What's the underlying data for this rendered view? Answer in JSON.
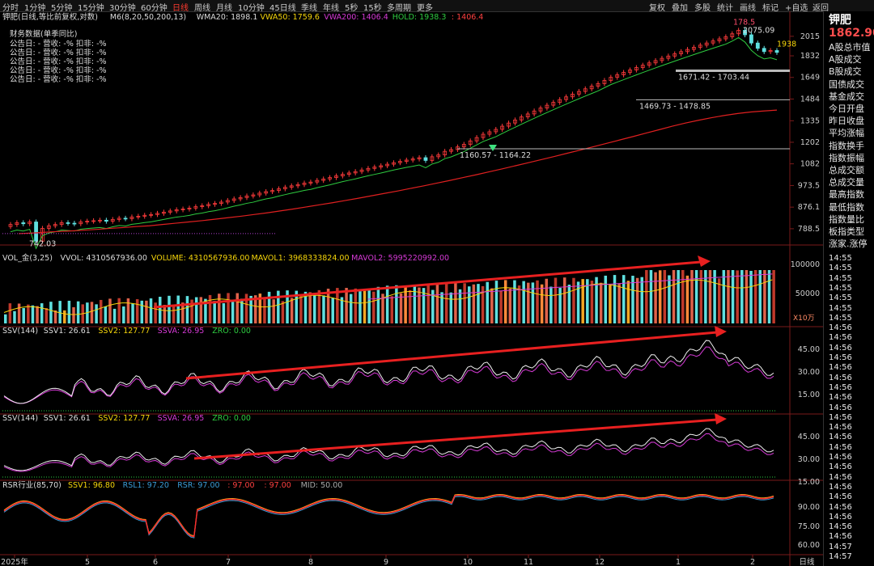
{
  "toolbar": {
    "left_items": [
      "分时",
      "1分钟",
      "5分钟",
      "15分钟",
      "30分钟",
      "60分钟",
      "日线",
      "周线",
      "月线",
      "10分钟",
      "45日线",
      "季线",
      "年线",
      "5秒",
      "15秒",
      "多周期",
      "更多"
    ],
    "active": "日线",
    "right_items": [
      "复权",
      "叠加",
      "多股",
      "统计",
      "画线",
      "标记",
      "+自选",
      "返回"
    ]
  },
  "right_panel": {
    "stock": "钾肥",
    "price": "1862.90",
    "items": [
      "A股总市值",
      "A股成交",
      "B股成交",
      "国债成交",
      "基金成交",
      "今日开盘",
      "昨日收盘",
      "平均涨幅",
      "指数换手",
      "指数振幅",
      "总成交额",
      "总成交量",
      "最高指数",
      "最低指数",
      "指数量比",
      "板指类型",
      "涨家.涨停"
    ],
    "times": [
      "14:55",
      "14:55",
      "14:55",
      "14:55",
      "14:55",
      "14:55",
      "14:55",
      "14:56",
      "14:56",
      "14:56",
      "14:56",
      "14:56",
      "14:56",
      "14:56",
      "14:56",
      "14:56",
      "14:56",
      "14:56",
      "14:56",
      "14:56",
      "14:56",
      "14:56",
      "14:56",
      "14:56",
      "14:56",
      "14:56",
      "14:56",
      "14:56",
      "14:56",
      "14:57",
      "14:57"
    ]
  },
  "panel_headers": {
    "main": [
      {
        "text": "钾肥(日线,等比前复权,对数)",
        "color": "#dddddd"
      },
      {
        "text": "M6(8,20,50,200,13)",
        "color": "#dddddd"
      },
      {
        "text": "WMA20: 1898.1",
        "color": "#dddddd"
      },
      {
        "text": "VWA50: 1759.6",
        "color": "#f5d50a"
      },
      {
        "text": "VWA200: 1406.4",
        "color": "#d63ad6"
      },
      {
        "text": "HOLD: 1938.3",
        "color": "#2ecc40"
      },
      {
        "text": ": 1406.4",
        "color": "#ff4040"
      }
    ],
    "finance_title": "财务数据(单季同比)",
    "finance_rows": [
      "公告日: -  营收: -%  扣非: -%",
      "公告日: -  营收: -%  扣非: -%",
      "公告日: -  营收: -%  扣非: -%",
      "公告日: -  营收: -%  扣非: -%",
      "公告日: -  营收: -%  扣非: -%"
    ],
    "vol": [
      {
        "text": "VOL_金(3,25)",
        "color": "#dddddd"
      },
      {
        "text": "VVOL: 4310567936.00",
        "color": "#dddddd"
      },
      {
        "text": "VOLUME: 4310567936.00",
        "color": "#f5d50a"
      },
      {
        "text": "MAVOL1: 3968333824.00",
        "color": "#f5d50a"
      },
      {
        "text": "MAVOL2: 5995220992.00",
        "color": "#d63ad6"
      }
    ],
    "ssv1": [
      {
        "text": "SSV(144)",
        "color": "#dddddd"
      },
      {
        "text": "SSV1: 26.61",
        "color": "#dddddd"
      },
      {
        "text": "SSV2: 127.77",
        "color": "#f5d50a"
      },
      {
        "text": "SSVA: 26.95",
        "color": "#d63ad6"
      },
      {
        "text": "ZRO: 0.00",
        "color": "#2ecc40"
      }
    ],
    "ssv2": [
      {
        "text": "SSV(144)",
        "color": "#dddddd"
      },
      {
        "text": "SSV1: 26.61",
        "color": "#dddddd"
      },
      {
        "text": "SSV2: 127.77",
        "color": "#f5d50a"
      },
      {
        "text": "SSVA: 26.95",
        "color": "#d63ad6"
      },
      {
        "text": "ZRO: 0.00",
        "color": "#2ecc40"
      }
    ],
    "rsr": [
      {
        "text": "RSR行业(85,70)",
        "color": "#dddddd"
      },
      {
        "text": "SSV1: 96.80",
        "color": "#f5d50a"
      },
      {
        "text": "RSL1: 97.20",
        "color": "#3a9bd6"
      },
      {
        "text": "RSR: 97.00",
        "color": "#3a9bd6"
      },
      {
        "text": ": 97.00",
        "color": "#ff4040"
      },
      {
        "text": ": 97.00",
        "color": "#ff4040"
      },
      {
        "text": "MID: 50.00",
        "color": "#aaaaaa"
      }
    ]
  },
  "chart_data": {
    "type": "line",
    "price_axis_ticks": [
      "2015",
      "1832",
      "1649",
      "1484",
      "1335",
      "1202",
      "1082",
      "973.5",
      "876.1",
      "788.5"
    ],
    "price_range": [
      740,
      2120
    ],
    "months": [
      "2025年",
      "5",
      "6",
      "7",
      "8",
      "9",
      "10",
      "11",
      "12",
      "1",
      "2"
    ],
    "period_label": "日线",
    "close": [
      805,
      812,
      808,
      815,
      742,
      790,
      800,
      805,
      812,
      810,
      808,
      815,
      818,
      820,
      822,
      818,
      825,
      830,
      828,
      835,
      838,
      842,
      845,
      850,
      855,
      860,
      865,
      868,
      872,
      878,
      882,
      888,
      892,
      898,
      905,
      912,
      918,
      925,
      930,
      938,
      945,
      950,
      958,
      965,
      972,
      978,
      985,
      990,
      998,
      1005,
      1012,
      1020,
      1028,
      1035,
      1042,
      1050,
      1058,
      1065,
      1072,
      1080,
      1088,
      1095,
      1102,
      1108,
      1115,
      1100,
      1120,
      1130,
      1150,
      1160,
      1175,
      1190,
      1210,
      1230,
      1250,
      1265,
      1280,
      1300,
      1320,
      1340,
      1360,
      1380,
      1400,
      1420,
      1440,
      1460,
      1480,
      1500,
      1520,
      1540,
      1560,
      1580,
      1600,
      1625,
      1650,
      1670,
      1690,
      1710,
      1730,
      1750,
      1770,
      1790,
      1810,
      1830,
      1850,
      1870,
      1890,
      1910,
      1930,
      1950,
      1970,
      1990,
      2010,
      2040,
      2075,
      2030,
      1950,
      1900,
      1870,
      1880,
      1862.9
    ],
    "vwa200": [
      770,
      772,
      775,
      778,
      780,
      783,
      786,
      790,
      793,
      797,
      800,
      805,
      810,
      815,
      820,
      826,
      832,
      838,
      845,
      852,
      860,
      868,
      877,
      886,
      895,
      905,
      915,
      926,
      937,
      948,
      960,
      972,
      985,
      998,
      1012,
      1026,
      1041,
      1056,
      1072,
      1088,
      1105,
      1122,
      1140,
      1158,
      1177,
      1196,
      1216,
      1236,
      1257,
      1278,
      1300,
      1320,
      1338,
      1355,
      1370,
      1383,
      1393,
      1400,
      1406.4
    ],
    "annotations": [
      {
        "label": "742.03",
        "price": 742.03
      },
      {
        "label": "1160.57 - 1164.22",
        "price": 1164.22
      },
      {
        "label": "1469.73 - 1478.85",
        "price": 1478.85
      },
      {
        "label": "1671.42 - 1703.44",
        "price": 1703.44
      },
      {
        "label": "2075.09",
        "price": 2075.09
      },
      {
        "label": "178.5",
        "price": 2100
      },
      {
        "label": "1938",
        "price": 1938.3
      }
    ],
    "vol_ticks": [
      "100000",
      "50000"
    ],
    "vol_unit": "X10万",
    "ssv_ticks": [
      "45.00",
      "30.00",
      "15.00"
    ],
    "rsr_ticks": [
      "90.00",
      "75.00",
      "60.00"
    ]
  }
}
